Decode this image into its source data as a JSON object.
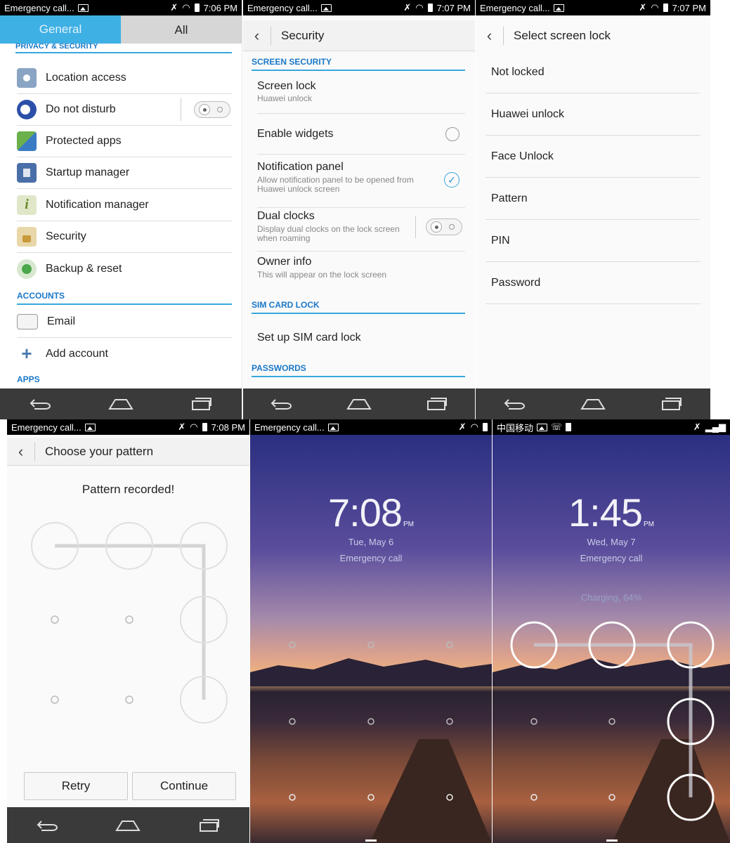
{
  "p1": {
    "status": {
      "left": "Emergency call...",
      "time": "7:06 PM"
    },
    "tabs": {
      "general": "General",
      "all": "All"
    },
    "section_privacy": "PRIVACY & SECURITY",
    "items": [
      {
        "label": "Location access"
      },
      {
        "label": "Do not disturb"
      },
      {
        "label": "Protected apps"
      },
      {
        "label": "Startup manager"
      },
      {
        "label": "Notification manager"
      },
      {
        "label": "Security"
      },
      {
        "label": "Backup & reset"
      }
    ],
    "section_accounts": "ACCOUNTS",
    "accounts": [
      {
        "label": "Email"
      },
      {
        "label": "Add account"
      }
    ],
    "section_apps": "APPS"
  },
  "p2": {
    "status": {
      "left": "Emergency call...",
      "time": "7:07 PM"
    },
    "title": "Security",
    "section_screen": "SCREEN SECURITY",
    "screen_lock": {
      "title": "Screen lock",
      "sub": "Huawei unlock"
    },
    "widgets": {
      "title": "Enable widgets"
    },
    "notif": {
      "title": "Notification panel",
      "sub1": "Allow notification panel to be opened from",
      "sub2": "Huawei unlock screen"
    },
    "dual": {
      "title": "Dual clocks",
      "sub1": "Display dual clocks on the lock screen",
      "sub2": "when roaming"
    },
    "owner": {
      "title": "Owner info",
      "sub": "This will appear on the lock screen"
    },
    "section_sim": "SIM CARD LOCK",
    "sim": {
      "title": "Set up SIM card lock"
    },
    "section_pw": "PASSWORDS"
  },
  "p3": {
    "status": {
      "left": "Emergency call...",
      "time": "7:07 PM"
    },
    "title": "Select screen lock",
    "options": [
      "Not locked",
      "Huawei unlock",
      "Face Unlock",
      "Pattern",
      "PIN",
      "Password"
    ]
  },
  "p4": {
    "status": {
      "left": "Emergency call...",
      "time": "7:08 PM"
    },
    "title": "Choose your pattern",
    "message": "Pattern recorded!",
    "retry": "Retry",
    "continue": "Continue"
  },
  "p5": {
    "status": {
      "left": "Emergency call..."
    },
    "time": "7:08",
    "ampm": "PM",
    "date": "Tue, May 6",
    "emergency": "Emergency call"
  },
  "p6": {
    "status": {
      "left": "中国移动"
    },
    "time": "1:45",
    "ampm": "PM",
    "date": "Wed, May 7",
    "emergency": "Emergency call",
    "charging": "Charging, 64%"
  },
  "colors": {
    "accent": "#38a8dd",
    "section": "#1a78c8",
    "nav": "#3a3a3a"
  }
}
